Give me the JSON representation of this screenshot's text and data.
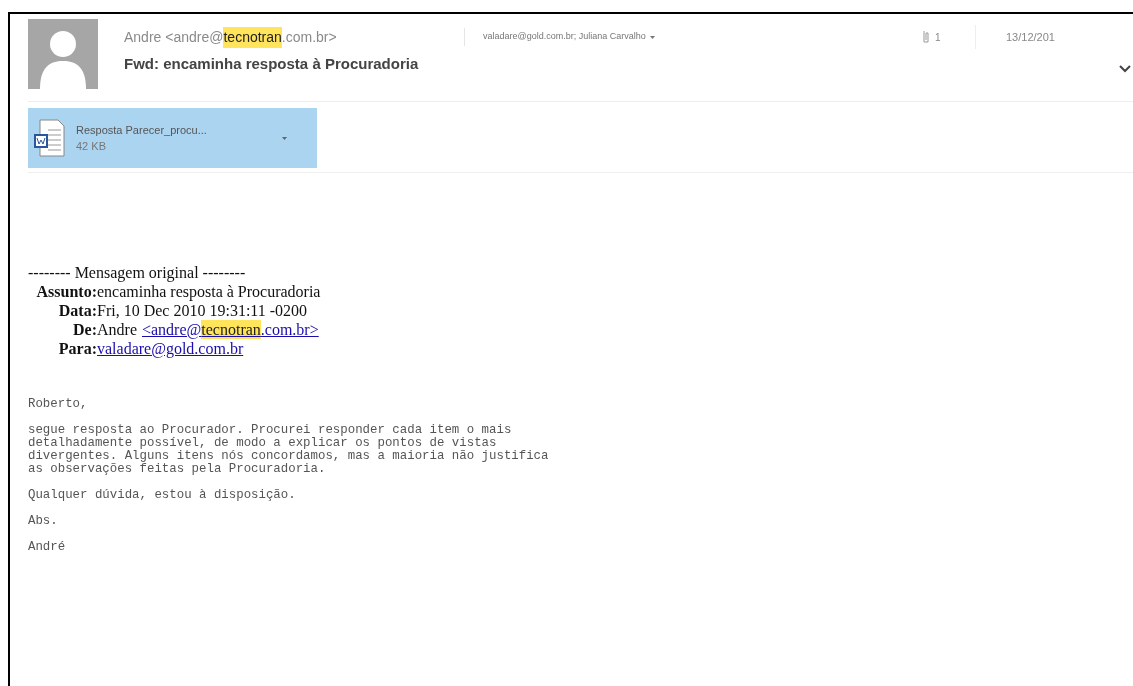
{
  "header": {
    "sender_parts": [
      {
        "text": "Andre <andre@",
        "highlighted": false
      },
      {
        "text": "tecnotran",
        "highlighted": true
      },
      {
        "text": ".com.br>",
        "highlighted": false
      }
    ],
    "recipients": "valadare@gold.com.br; Juliana Carvalho",
    "attachment_count": "1",
    "date": "13/12/201",
    "subject": "Fwd: encaminha resposta à Procuradoria"
  },
  "attachment": {
    "name": "Resposta Parecer_procu...",
    "size": "42 KB",
    "selected": true
  },
  "forwarded": {
    "separator": "-------- Mensagem original --------",
    "fields": [
      {
        "label": "Assunto:",
        "kind": "text",
        "parts": [
          {
            "text": "encaminha resposta à Procuradoria",
            "highlighted": false
          }
        ]
      },
      {
        "label": "Data:",
        "kind": "text",
        "parts": [
          {
            "text": "Fri, 10 Dec 2010 19:31:11 -0200",
            "highlighted": false
          }
        ]
      },
      {
        "label": "De:",
        "kind": "sender",
        "name": "Andre",
        "parts": [
          {
            "text": "<andre@",
            "highlighted": false
          },
          {
            "text": "tecnotran",
            "highlighted": true
          },
          {
            "text": ".com.br>",
            "highlighted": false
          }
        ]
      },
      {
        "label": "Para:",
        "kind": "link",
        "parts": [
          {
            "text": "valadare@gold.com.br",
            "highlighted": false
          }
        ]
      }
    ]
  },
  "body": [
    "Roberto,",
    "segue resposta ao Procurador. Procurei responder cada item o mais\ndetalhadamente possível, de modo a explicar os pontos de vistas\ndivergentes. Alguns itens nós concordamos, mas a maioria não justifica\nas observações feitas pela Procuradoria.",
    "Qualquer dúvida, estou à disposição.",
    "Abs.",
    "André"
  ]
}
